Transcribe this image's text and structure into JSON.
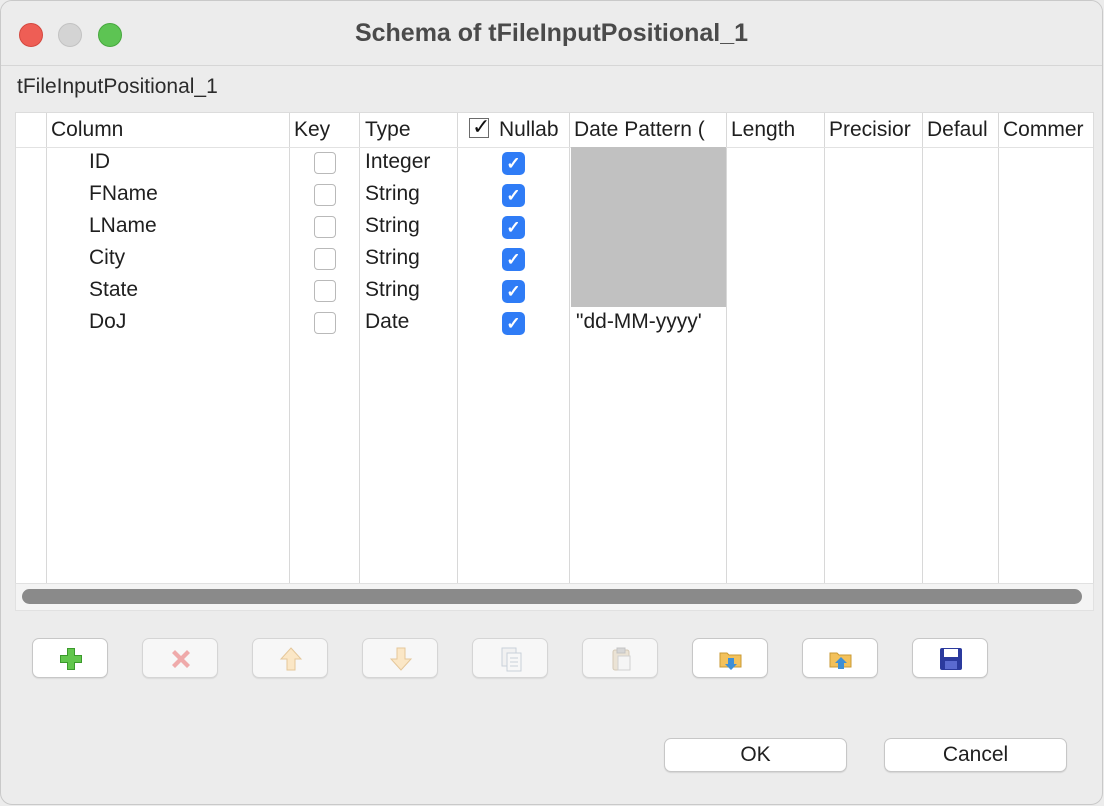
{
  "window": {
    "title": "Schema of tFileInputPositional_1"
  },
  "subtitle": "tFileInputPositional_1",
  "table": {
    "columns": [
      "Column",
      "Key",
      "Type",
      "Nullab",
      "Date Pattern (",
      "Length",
      "Precisior",
      "Defaul",
      "Commer"
    ],
    "rows": [
      {
        "name": "ID",
        "key": false,
        "type": "Integer",
        "nullable": true,
        "date_pattern": ""
      },
      {
        "name": "FName",
        "key": false,
        "type": "String",
        "nullable": true,
        "date_pattern": ""
      },
      {
        "name": "LName",
        "key": false,
        "type": "String",
        "nullable": true,
        "date_pattern": ""
      },
      {
        "name": "City",
        "key": false,
        "type": "String",
        "nullable": true,
        "date_pattern": ""
      },
      {
        "name": "State",
        "key": false,
        "type": "String",
        "nullable": true,
        "date_pattern": ""
      },
      {
        "name": "DoJ",
        "key": false,
        "type": "Date",
        "nullable": true,
        "date_pattern": "\"dd-MM-yyyy'"
      }
    ]
  },
  "toolbar": {
    "buttons": [
      "add-icon",
      "remove-icon",
      "move-up-icon",
      "move-down-icon",
      "copy-icon",
      "paste-icon",
      "import-icon",
      "export-icon",
      "save-icon"
    ]
  },
  "dialog": {
    "ok_label": "OK",
    "cancel_label": "Cancel"
  },
  "colors": {
    "accent": "#2f7cf6",
    "close": "#ee5e55",
    "maximize": "#5dc453"
  }
}
